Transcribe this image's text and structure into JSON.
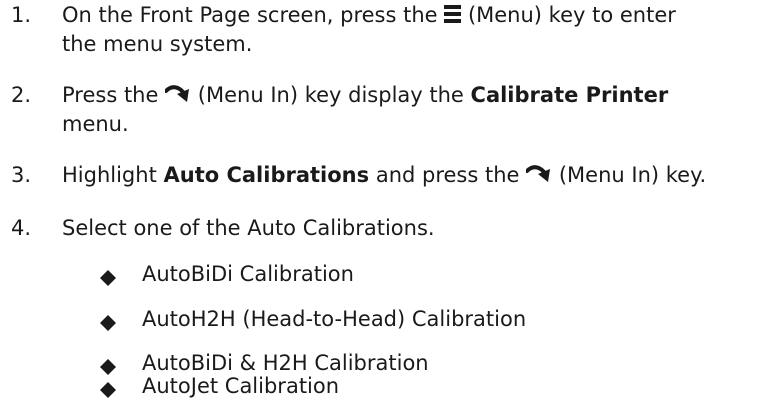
{
  "steps": [
    {
      "number": "1.",
      "line1_a": "On the Front Page screen, press the",
      "line1_b": "(Menu) key to enter",
      "line2": "the menu system.",
      "icon": "menu-icon"
    },
    {
      "number": "2.",
      "line1_a": "Press the",
      "line1_b": "(Menu In) key display the",
      "line1_bold": "Calibrate Printer",
      "line2": "menu.",
      "icon": "menu-in-arrow-icon"
    },
    {
      "number": "3.",
      "line1_a": "Highlight",
      "line1_bold": "Auto Calibrations",
      "line1_b": "and press the",
      "line1_c": "(Menu In) key.",
      "icon": "menu-in-arrow-icon"
    },
    {
      "number": "4.",
      "line1_a": "Select one of the Auto Calibrations."
    }
  ],
  "bullets": [
    "AutoBiDi Calibration",
    "AutoH2H (Head-to-Head) Calibration",
    "AutoBiDi & H2H Calibration",
    "AutoJet Calibration"
  ]
}
